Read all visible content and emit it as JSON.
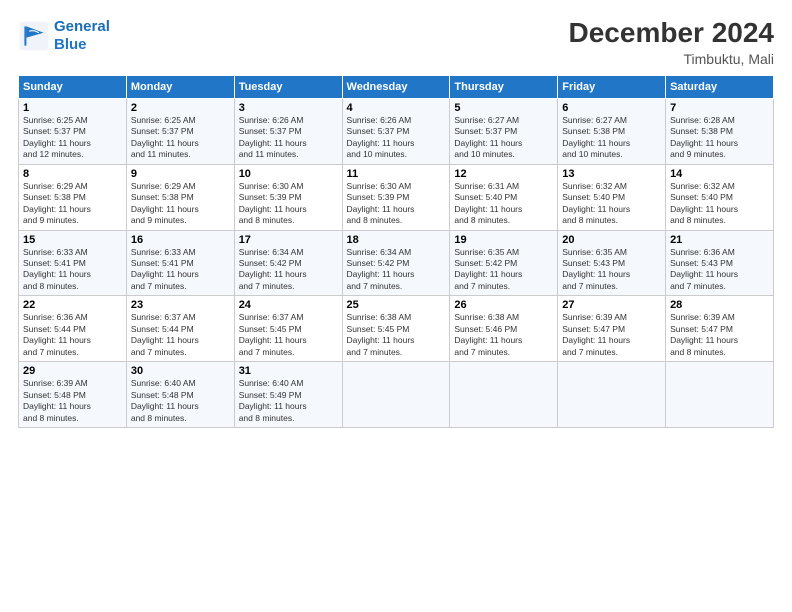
{
  "logo": {
    "line1": "General",
    "line2": "Blue"
  },
  "title": "December 2024",
  "subtitle": "Timbuktu, Mali",
  "days_of_week": [
    "Sunday",
    "Monday",
    "Tuesday",
    "Wednesday",
    "Thursday",
    "Friday",
    "Saturday"
  ],
  "weeks": [
    [
      {
        "day": "1",
        "detail": "Sunrise: 6:25 AM\nSunset: 5:37 PM\nDaylight: 11 hours\nand 12 minutes."
      },
      {
        "day": "2",
        "detail": "Sunrise: 6:25 AM\nSunset: 5:37 PM\nDaylight: 11 hours\nand 11 minutes."
      },
      {
        "day": "3",
        "detail": "Sunrise: 6:26 AM\nSunset: 5:37 PM\nDaylight: 11 hours\nand 11 minutes."
      },
      {
        "day": "4",
        "detail": "Sunrise: 6:26 AM\nSunset: 5:37 PM\nDaylight: 11 hours\nand 10 minutes."
      },
      {
        "day": "5",
        "detail": "Sunrise: 6:27 AM\nSunset: 5:37 PM\nDaylight: 11 hours\nand 10 minutes."
      },
      {
        "day": "6",
        "detail": "Sunrise: 6:27 AM\nSunset: 5:38 PM\nDaylight: 11 hours\nand 10 minutes."
      },
      {
        "day": "7",
        "detail": "Sunrise: 6:28 AM\nSunset: 5:38 PM\nDaylight: 11 hours\nand 9 minutes."
      }
    ],
    [
      {
        "day": "8",
        "detail": "Sunrise: 6:29 AM\nSunset: 5:38 PM\nDaylight: 11 hours\nand 9 minutes."
      },
      {
        "day": "9",
        "detail": "Sunrise: 6:29 AM\nSunset: 5:38 PM\nDaylight: 11 hours\nand 9 minutes."
      },
      {
        "day": "10",
        "detail": "Sunrise: 6:30 AM\nSunset: 5:39 PM\nDaylight: 11 hours\nand 8 minutes."
      },
      {
        "day": "11",
        "detail": "Sunrise: 6:30 AM\nSunset: 5:39 PM\nDaylight: 11 hours\nand 8 minutes."
      },
      {
        "day": "12",
        "detail": "Sunrise: 6:31 AM\nSunset: 5:40 PM\nDaylight: 11 hours\nand 8 minutes."
      },
      {
        "day": "13",
        "detail": "Sunrise: 6:32 AM\nSunset: 5:40 PM\nDaylight: 11 hours\nand 8 minutes."
      },
      {
        "day": "14",
        "detail": "Sunrise: 6:32 AM\nSunset: 5:40 PM\nDaylight: 11 hours\nand 8 minutes."
      }
    ],
    [
      {
        "day": "15",
        "detail": "Sunrise: 6:33 AM\nSunset: 5:41 PM\nDaylight: 11 hours\nand 8 minutes."
      },
      {
        "day": "16",
        "detail": "Sunrise: 6:33 AM\nSunset: 5:41 PM\nDaylight: 11 hours\nand 7 minutes."
      },
      {
        "day": "17",
        "detail": "Sunrise: 6:34 AM\nSunset: 5:42 PM\nDaylight: 11 hours\nand 7 minutes."
      },
      {
        "day": "18",
        "detail": "Sunrise: 6:34 AM\nSunset: 5:42 PM\nDaylight: 11 hours\nand 7 minutes."
      },
      {
        "day": "19",
        "detail": "Sunrise: 6:35 AM\nSunset: 5:42 PM\nDaylight: 11 hours\nand 7 minutes."
      },
      {
        "day": "20",
        "detail": "Sunrise: 6:35 AM\nSunset: 5:43 PM\nDaylight: 11 hours\nand 7 minutes."
      },
      {
        "day": "21",
        "detail": "Sunrise: 6:36 AM\nSunset: 5:43 PM\nDaylight: 11 hours\nand 7 minutes."
      }
    ],
    [
      {
        "day": "22",
        "detail": "Sunrise: 6:36 AM\nSunset: 5:44 PM\nDaylight: 11 hours\nand 7 minutes."
      },
      {
        "day": "23",
        "detail": "Sunrise: 6:37 AM\nSunset: 5:44 PM\nDaylight: 11 hours\nand 7 minutes."
      },
      {
        "day": "24",
        "detail": "Sunrise: 6:37 AM\nSunset: 5:45 PM\nDaylight: 11 hours\nand 7 minutes."
      },
      {
        "day": "25",
        "detail": "Sunrise: 6:38 AM\nSunset: 5:45 PM\nDaylight: 11 hours\nand 7 minutes."
      },
      {
        "day": "26",
        "detail": "Sunrise: 6:38 AM\nSunset: 5:46 PM\nDaylight: 11 hours\nand 7 minutes."
      },
      {
        "day": "27",
        "detail": "Sunrise: 6:39 AM\nSunset: 5:47 PM\nDaylight: 11 hours\nand 7 minutes."
      },
      {
        "day": "28",
        "detail": "Sunrise: 6:39 AM\nSunset: 5:47 PM\nDaylight: 11 hours\nand 8 minutes."
      }
    ],
    [
      {
        "day": "29",
        "detail": "Sunrise: 6:39 AM\nSunset: 5:48 PM\nDaylight: 11 hours\nand 8 minutes."
      },
      {
        "day": "30",
        "detail": "Sunrise: 6:40 AM\nSunset: 5:48 PM\nDaylight: 11 hours\nand 8 minutes."
      },
      {
        "day": "31",
        "detail": "Sunrise: 6:40 AM\nSunset: 5:49 PM\nDaylight: 11 hours\nand 8 minutes."
      },
      {
        "day": "",
        "detail": ""
      },
      {
        "day": "",
        "detail": ""
      },
      {
        "day": "",
        "detail": ""
      },
      {
        "day": "",
        "detail": ""
      }
    ]
  ]
}
